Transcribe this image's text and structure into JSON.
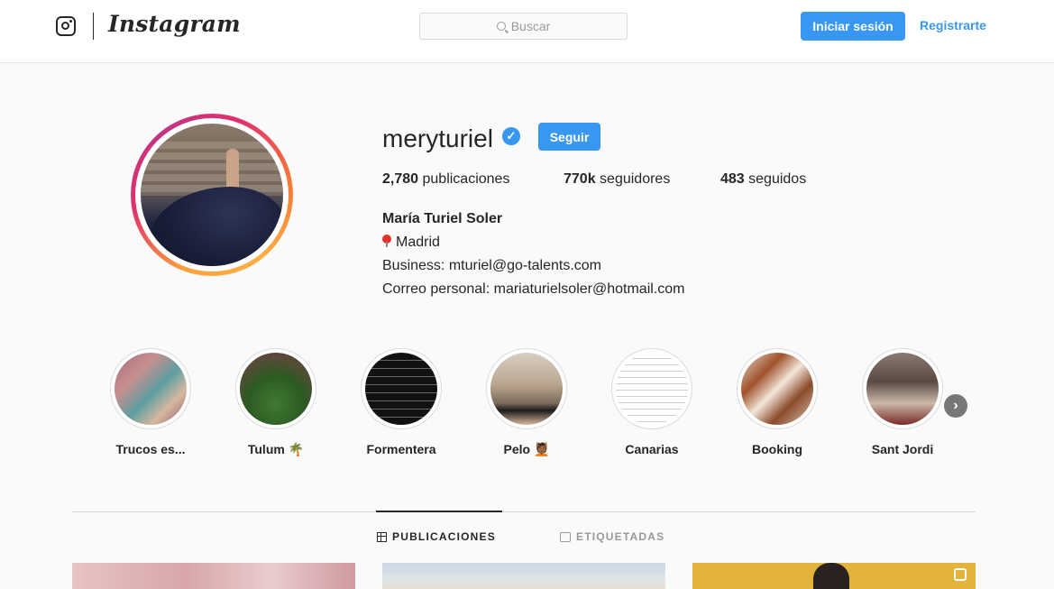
{
  "header": {
    "wordmark": "Instagram",
    "search_placeholder": "Buscar",
    "login_label": "Iniciar sesión",
    "register_label": "Registrarte"
  },
  "profile": {
    "username": "meryturiel",
    "verified_icon": "✓",
    "follow_label": "Seguir",
    "stats": {
      "posts_count": "2,780",
      "posts_label": "publicaciones",
      "followers_count": "770k",
      "followers_label": "seguidores",
      "following_count": "483",
      "following_label": "seguidos"
    },
    "full_name": "María Turiel Soler",
    "location": "Madrid",
    "business_line": "Business: mturiel@go-talents.com",
    "personal_line": "Correo personal: mariaturielsoler@hotmail.com"
  },
  "highlights": [
    {
      "label": "Trucos es..."
    },
    {
      "label": "Tulum 🌴"
    },
    {
      "label": "Formentera"
    },
    {
      "label": "Pelo 💆🏾"
    },
    {
      "label": "Canarias"
    },
    {
      "label": "Booking"
    },
    {
      "label": "Sant Jordi"
    }
  ],
  "tabs": {
    "posts_label": "PUBLICACIONES",
    "tagged_label": "ETIQUETADAS"
  },
  "colors": {
    "accent": "#3897f0",
    "text": "#262626",
    "muted": "#999999",
    "background": "#fafafa"
  }
}
